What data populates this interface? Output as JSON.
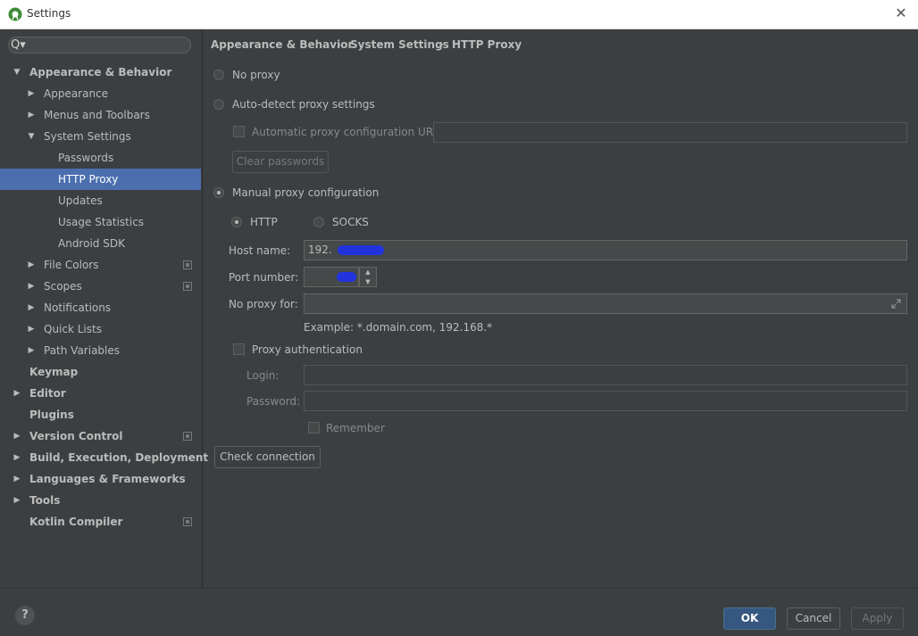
{
  "window": {
    "title": "Settings",
    "close_glyph": "✕"
  },
  "search": {
    "icon": "Q▾",
    "placeholder": ""
  },
  "tree": [
    {
      "label": "Appearance & Behavior",
      "bold": true,
      "arrow": "▼",
      "indent": 0
    },
    {
      "label": "Appearance",
      "arrow": "▶",
      "indent": 1
    },
    {
      "label": "Menus and Toolbars",
      "arrow": "▶",
      "indent": 1
    },
    {
      "label": "System Settings",
      "arrow": "▼",
      "indent": 1
    },
    {
      "label": "Passwords",
      "indent": 2
    },
    {
      "label": "HTTP Proxy",
      "indent": 2,
      "selected": true
    },
    {
      "label": "Updates",
      "indent": 2
    },
    {
      "label": "Usage Statistics",
      "indent": 2
    },
    {
      "label": "Android SDK",
      "indent": 2
    },
    {
      "label": "File Colors",
      "arrow": "▶",
      "indent": 1,
      "project": true
    },
    {
      "label": "Scopes",
      "arrow": "▶",
      "indent": 1,
      "project": true
    },
    {
      "label": "Notifications",
      "arrow": "▶",
      "indent": 1
    },
    {
      "label": "Quick Lists",
      "arrow": "▶",
      "indent": 1
    },
    {
      "label": "Path Variables",
      "arrow": "▶",
      "indent": 1
    },
    {
      "label": "Keymap",
      "bold": true,
      "indent": 0
    },
    {
      "label": "Editor",
      "bold": true,
      "arrow": "▶",
      "indent": 0
    },
    {
      "label": "Plugins",
      "bold": true,
      "indent": 0
    },
    {
      "label": "Version Control",
      "bold": true,
      "arrow": "▶",
      "indent": 0,
      "project": true
    },
    {
      "label": "Build, Execution, Deployment",
      "bold": true,
      "arrow": "▶",
      "indent": 0
    },
    {
      "label": "Languages & Frameworks",
      "bold": true,
      "arrow": "▶",
      "indent": 0
    },
    {
      "label": "Tools",
      "bold": true,
      "arrow": "▶",
      "indent": 0
    },
    {
      "label": "Kotlin Compiler",
      "bold": true,
      "indent": 0,
      "project": true
    }
  ],
  "breadcrumb": {
    "items": [
      "Appearance & Behavior",
      "System Settings",
      "HTTP Proxy"
    ],
    "separator": "›"
  },
  "proxy": {
    "no_proxy": "No proxy",
    "auto_detect": "Auto-detect proxy settings",
    "auto_config_url_label": "Automatic proxy configuration URL:",
    "auto_config_url_value": "",
    "clear_passwords": "Clear passwords",
    "manual": "Manual proxy configuration",
    "http": "HTTP",
    "socks": "SOCKS",
    "host_label": "Host name:",
    "host_value": "192.",
    "port_label": "Port number:",
    "port_value": "",
    "no_proxy_for_label": "No proxy for:",
    "no_proxy_for_value": "",
    "example": "Example: *.domain.com, 192.168.*",
    "proxy_auth": "Proxy authentication",
    "login_label": "Login:",
    "login_value": "",
    "password_label": "Password:",
    "password_value": "",
    "remember": "Remember",
    "check_connection": "Check connection"
  },
  "footer": {
    "help": "?",
    "ok": "OK",
    "cancel": "Cancel",
    "apply": "Apply"
  },
  "colors": {
    "background": "#3c3f41",
    "selection": "#4b6eaf",
    "primary_button": "#365880"
  }
}
